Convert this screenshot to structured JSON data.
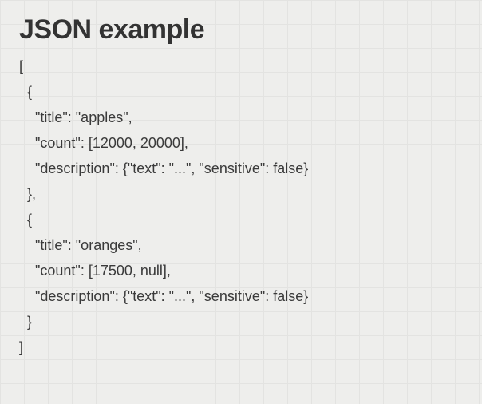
{
  "heading": "JSON example",
  "code_lines": [
    "[",
    "  {",
    "    \"title\": \"apples\",",
    "    \"count\": [12000, 20000],",
    "    \"description\": {\"text\": \"...\", \"sensitive\": false}",
    "  },",
    "  {",
    "    \"title\": \"oranges\",",
    "    \"count\": [17500, null],",
    "    \"description\": {\"text\": \"...\", \"sensitive\": false}",
    "  }",
    "]"
  ]
}
